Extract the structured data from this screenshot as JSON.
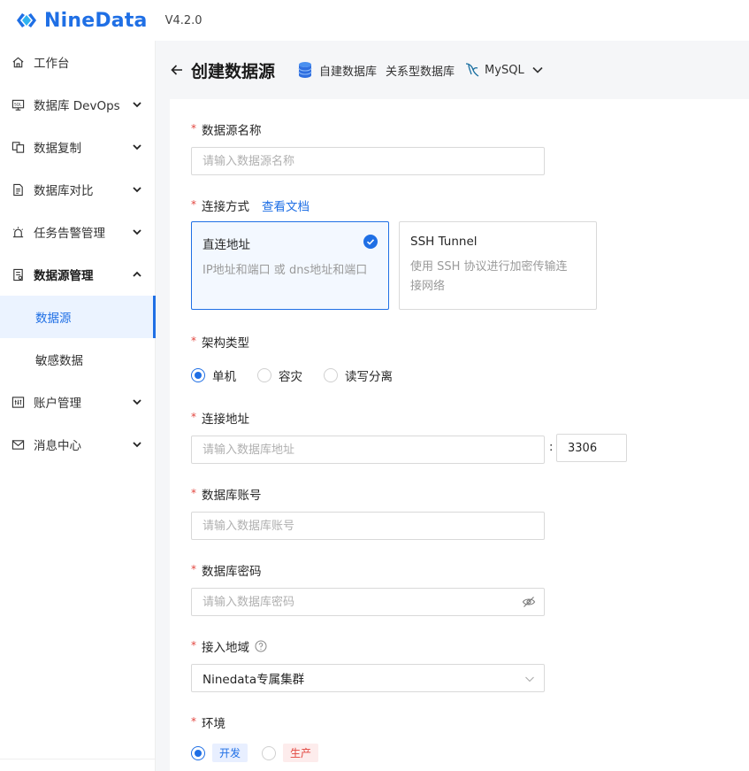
{
  "app": {
    "name": "NineData",
    "version": "V4.2.0",
    "brand_color": "#1f6fe5"
  },
  "sidebar": {
    "items": [
      {
        "label": "工作台",
        "icon": "home-icon",
        "expandable": false
      },
      {
        "label": "数据库 DevOps",
        "icon": "monitor-sql-icon",
        "expandable": true
      },
      {
        "label": "数据复制",
        "icon": "copy-icon",
        "expandable": true
      },
      {
        "label": "数据库对比",
        "icon": "compare-doc-icon",
        "expandable": true
      },
      {
        "label": "任务告警管理",
        "icon": "alarm-icon",
        "expandable": true
      },
      {
        "label": "数据源管理",
        "icon": "datasource-icon",
        "expandable": true,
        "expanded": true,
        "children": [
          {
            "label": "数据源",
            "active": true
          },
          {
            "label": "敏感数据",
            "active": false
          }
        ]
      },
      {
        "label": "账户管理",
        "icon": "account-icon",
        "expandable": true
      },
      {
        "label": "消息中心",
        "icon": "mail-icon",
        "expandable": true
      }
    ]
  },
  "header": {
    "title": "创建数据源",
    "crumbs": [
      "自建数据库",
      "关系型数据库"
    ],
    "db_type": "MySQL"
  },
  "form": {
    "name": {
      "label": "数据源名称",
      "placeholder": "请输入数据源名称",
      "value": ""
    },
    "connection": {
      "label": "连接方式",
      "doc_link": "查看文档",
      "options": [
        {
          "title": "直连地址",
          "desc": "IP地址和端口 或 dns地址和端口",
          "selected": true
        },
        {
          "title": "SSH Tunnel",
          "desc_line1": "使用 SSH 协议进行加密传输连",
          "desc_line2": "接网络",
          "selected": false
        }
      ]
    },
    "architecture": {
      "label": "架构类型",
      "options": [
        {
          "label": "单机",
          "selected": true
        },
        {
          "label": "容灾",
          "selected": false
        },
        {
          "label": "读写分离",
          "selected": false
        }
      ]
    },
    "address": {
      "label": "连接地址",
      "placeholder": "请输入数据库地址",
      "separator": ":",
      "port": "3306"
    },
    "account": {
      "label": "数据库账号",
      "placeholder": "请输入数据库账号"
    },
    "password": {
      "label": "数据库密码",
      "placeholder": "请输入数据库密码"
    },
    "region": {
      "label": "接入地域",
      "value": "Ninedata专属集群"
    },
    "environment": {
      "label": "环境",
      "options": [
        {
          "label": "开发",
          "selected": true,
          "color": "#1f6fe5"
        },
        {
          "label": "生产",
          "selected": false,
          "color": "#e2463f"
        }
      ]
    }
  }
}
